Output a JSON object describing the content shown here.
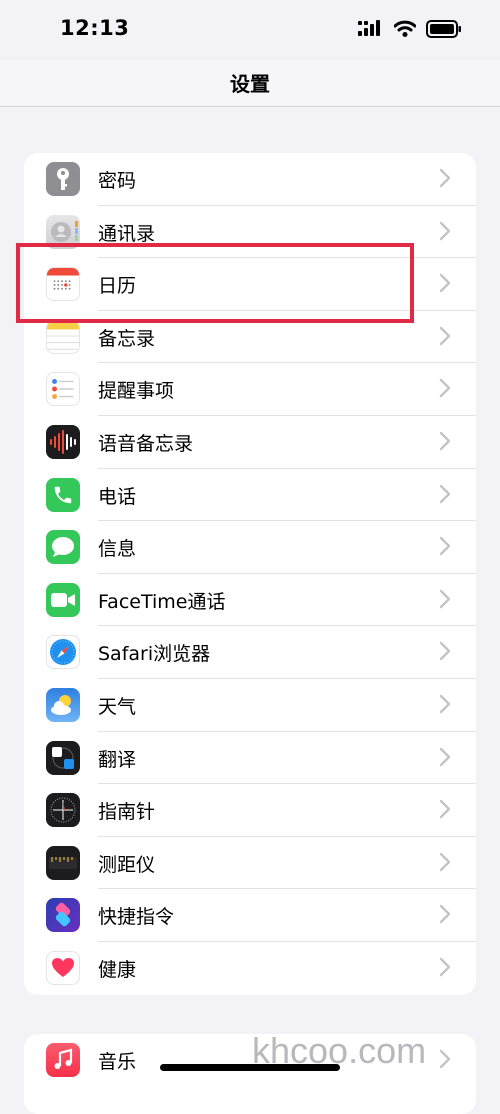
{
  "status": {
    "time": "12:13"
  },
  "nav": {
    "title": "设置"
  },
  "settings": [
    {
      "id": "passwords",
      "label": "密码",
      "icon": "key-icon"
    },
    {
      "id": "contacts",
      "label": "通讯录",
      "icon": "contacts-icon"
    },
    {
      "id": "calendar",
      "label": "日历",
      "icon": "calendar-icon"
    },
    {
      "id": "notes",
      "label": "备忘录",
      "icon": "notes-icon"
    },
    {
      "id": "reminders",
      "label": "提醒事项",
      "icon": "reminders-icon"
    },
    {
      "id": "voice-memos",
      "label": "语音备忘录",
      "icon": "voice-memos-icon"
    },
    {
      "id": "phone",
      "label": "电话",
      "icon": "phone-icon"
    },
    {
      "id": "messages",
      "label": "信息",
      "icon": "messages-icon"
    },
    {
      "id": "facetime",
      "label": "FaceTime通话",
      "icon": "facetime-icon"
    },
    {
      "id": "safari",
      "label": "Safari浏览器",
      "icon": "safari-icon"
    },
    {
      "id": "weather",
      "label": "天气",
      "icon": "weather-icon"
    },
    {
      "id": "translate",
      "label": "翻译",
      "icon": "translate-icon"
    },
    {
      "id": "compass",
      "label": "指南针",
      "icon": "compass-icon"
    },
    {
      "id": "measure",
      "label": "测距仪",
      "icon": "measure-icon"
    },
    {
      "id": "shortcuts",
      "label": "快捷指令",
      "icon": "shortcuts-icon"
    },
    {
      "id": "health",
      "label": "健康",
      "icon": "health-icon"
    }
  ],
  "settings2": [
    {
      "id": "music",
      "label": "音乐",
      "icon": "music-icon"
    }
  ],
  "watermark": "khcoo.com",
  "colors": {
    "highlight": "#e02a46",
    "background": "#f2f2f7"
  }
}
